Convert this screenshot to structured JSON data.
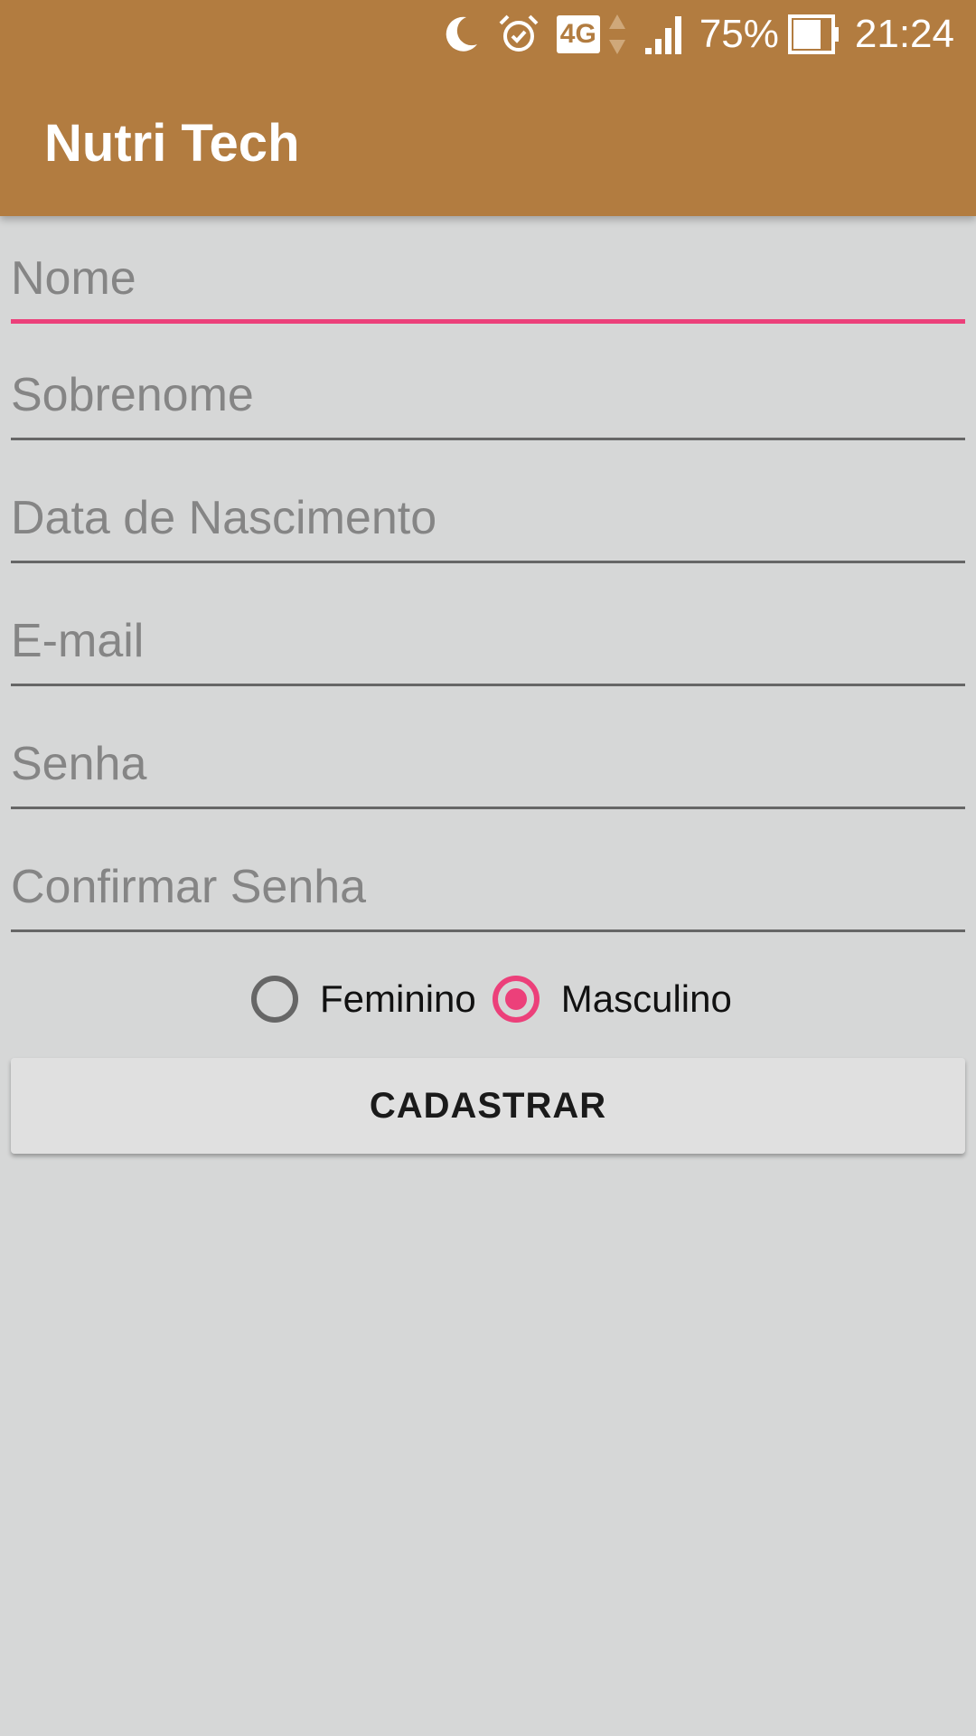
{
  "status_bar": {
    "icons": [
      "moon-icon",
      "alarm-icon",
      "network-4g-badge",
      "data-arrows-icon",
      "signal-icon",
      "battery-icon"
    ],
    "network": "4G",
    "battery_percent": "75%",
    "time": "21:24"
  },
  "app_bar": {
    "title": "Nutri Tech",
    "color": "#b27c40"
  },
  "form": {
    "fields": [
      {
        "placeholder": "Nome",
        "value": "",
        "focused": true
      },
      {
        "placeholder": "Sobrenome",
        "value": ""
      },
      {
        "placeholder": "Data de Nascimento",
        "value": ""
      },
      {
        "placeholder": "E-mail",
        "value": ""
      },
      {
        "placeholder": "Senha",
        "value": ""
      },
      {
        "placeholder": "Confirmar Senha",
        "value": ""
      }
    ],
    "gender": {
      "options": [
        "Feminino",
        "Masculino"
      ],
      "selected": "Masculino"
    },
    "submit_label": "CADASTRAR"
  },
  "colors": {
    "accent": "#ec407a",
    "background": "#d6d7d7",
    "underline": "#666666"
  }
}
